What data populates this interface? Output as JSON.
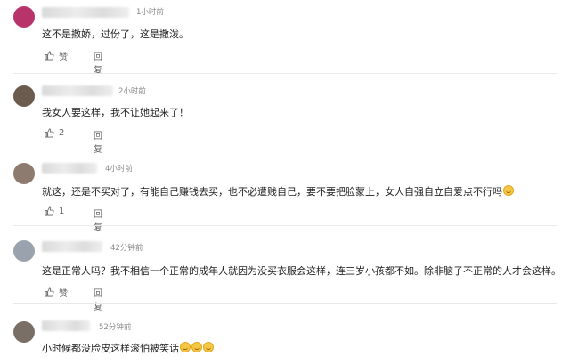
{
  "comments": [
    {
      "time": "1小时前",
      "text": "这不是撒娇，过份了，这是撒泼。",
      "like": "赞",
      "reply": "回复",
      "emoji_count": 0,
      "avatar_color": "#b8336a"
    },
    {
      "time": "2小时前",
      "text": "我女人要这样，我不让她起来了！",
      "like": "2",
      "reply": "回复",
      "emoji_count": 0,
      "avatar_color": "#6b5a4e"
    },
    {
      "time": "4小时前",
      "text": "就这，还是不买对了，有能自己赚钱去买，也不必遭贱自己，要不要把脸蒙上，女人自强自立自爱点不行吗",
      "like": "1",
      "reply": "回复",
      "emoji_count": 1,
      "avatar_color": "#8c7b6e"
    },
    {
      "time": "42分钟前",
      "text": "这是正常人吗？我不相信一个正常的成年人就因为没买衣服会这样，连三岁小孩都不如。除非脑子不正常的人才会这样。",
      "like": "赞",
      "reply": "回复",
      "emoji_count": 0,
      "avatar_color": "#9aa3ad"
    },
    {
      "time": "52分钟前",
      "text": "小时候都没脸皮这样滚怕被笑话",
      "like": "",
      "reply": "",
      "emoji_count": 3,
      "avatar_color": "#7a6f67"
    }
  ],
  "icons": {
    "like": "thumbs-up-icon",
    "emoji": "smiley-emoji-icon"
  }
}
